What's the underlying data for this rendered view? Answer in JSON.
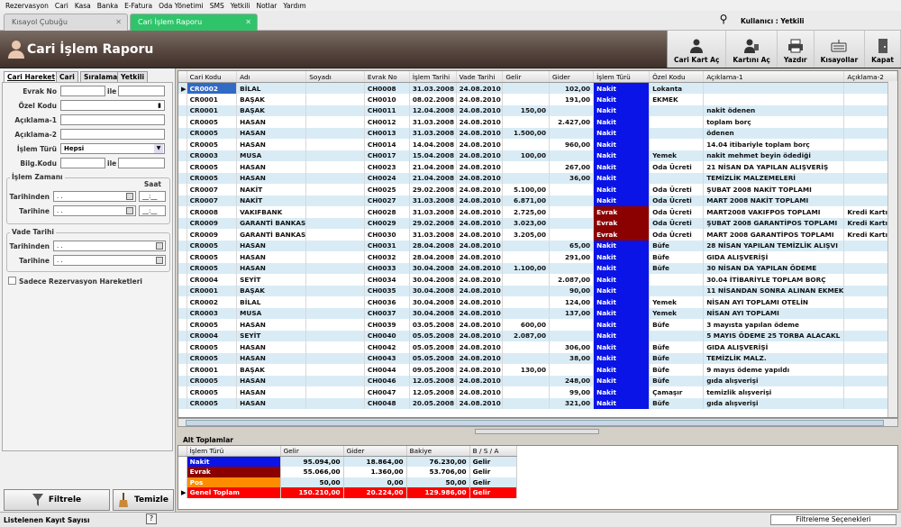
{
  "menu": [
    "Rezervasyon",
    "Cari",
    "Kasa",
    "Banka",
    "E-Fatura",
    "Oda Yönetimi",
    "SMS",
    "Yetkili",
    "Notlar",
    "Yardım"
  ],
  "tabs": [
    {
      "label": "Kısayol Çubuğu"
    },
    {
      "label": "Cari İşlem Raporu"
    }
  ],
  "user_label": "Kullanıcı : Yetkili",
  "page_title": "Cari İşlem Raporu",
  "toolbar": [
    "Cari Kart Aç",
    "Kartını Aç",
    "Yazdır",
    "Kısayollar",
    "Kapat"
  ],
  "left_tabs": [
    "Cari Hareket",
    "Cari",
    "Sıralama",
    "Yetkili"
  ],
  "form": {
    "evrak_no": "Evrak No",
    "ile": "ile",
    "ozel_kodu": "Özel Kodu",
    "aciklama1": "Açıklama-1",
    "aciklama2": "Açıklama-2",
    "islem_turu": "İşlem Türü",
    "islem_turu_value": "Hepsi",
    "bilg_kodu": "Bilg.Kodu",
    "islem_zamani": "İşlem Zamanı",
    "saat": "Saat",
    "tarihinden": "Tarihinden",
    "tarihine": "Tarihine",
    "vade_tarihi": "Vade Tarihi",
    "date_placeholder": " .  .",
    "time_placeholder": "__:__",
    "sadece": "Sadece Rezervasyon Hareketleri"
  },
  "buttons": {
    "filtrele": "Filtrele",
    "temizle": "Temizle"
  },
  "colors": {
    "nakit": "#0a14e6",
    "evrak": "#8b0000",
    "pos": "#ff8c00",
    "genel": "#ff0000"
  },
  "grid": {
    "columns": [
      "Cari Kodu",
      "Adı",
      "Soyadı",
      "Evrak No",
      "İşlem Tarihi",
      "Vade Tarihi",
      "Gelir",
      "Gider",
      "İşlem Türü",
      "Özel Kodu",
      "Açıklama-1",
      "Açıklama-2"
    ],
    "rows": [
      [
        "CR0002",
        "BİLAL",
        "",
        "CH0008",
        "31.03.2008",
        "24.08.2010",
        "",
        "102,00",
        "Nakit",
        "Lokanta",
        "",
        ""
      ],
      [
        "CR0001",
        "BAŞAK",
        "",
        "CH0010",
        "08.02.2008",
        "24.08.2010",
        "",
        "191,00",
        "Nakit",
        "EKMEK",
        "",
        ""
      ],
      [
        "CR0001",
        "BAŞAK",
        "",
        "CH0011",
        "12.04.2008",
        "24.08.2010",
        "150,00",
        "",
        "Nakit",
        "",
        "nakit ödenen",
        ""
      ],
      [
        "CR0005",
        "HASAN",
        "",
        "CH0012",
        "31.03.2008",
        "24.08.2010",
        "",
        "2.427,00",
        "Nakit",
        "",
        "toplam borç",
        ""
      ],
      [
        "CR0005",
        "HASAN",
        "",
        "CH0013",
        "31.03.2008",
        "24.08.2010",
        "1.500,00",
        "",
        "Nakit",
        "",
        "ödenen",
        ""
      ],
      [
        "CR0005",
        "HASAN",
        "",
        "CH0014",
        "14.04.2008",
        "24.08.2010",
        "",
        "960,00",
        "Nakit",
        "",
        "14.04 itibariyle toplam borç",
        ""
      ],
      [
        "CR0003",
        "MUSA",
        "",
        "CH0017",
        "15.04.2008",
        "24.08.2010",
        "100,00",
        "",
        "Nakit",
        "Yemek",
        "nakit mehmet beyin ödediği",
        ""
      ],
      [
        "CR0005",
        "HASAN",
        "",
        "CH0023",
        "21.04.2008",
        "24.08.2010",
        "",
        "267,00",
        "Nakit",
        "Oda Ücreti",
        "21 NİSAN DA YAPILAN ALIŞVERİŞ",
        ""
      ],
      [
        "CR0005",
        "HASAN",
        "",
        "CH0024",
        "21.04.2008",
        "24.08.2010",
        "",
        "36,00",
        "Nakit",
        "",
        "TEMİZLİK MALZEMELERİ",
        ""
      ],
      [
        "CR0007",
        "NAKİT",
        "",
        "CH0025",
        "29.02.2008",
        "24.08.2010",
        "5.100,00",
        "",
        "Nakit",
        "Oda Ücreti",
        "ŞUBAT 2008 NAKİT TOPLAMI",
        ""
      ],
      [
        "CR0007",
        "NAKİT",
        "",
        "CH0027",
        "31.03.2008",
        "24.08.2010",
        "6.871,00",
        "",
        "Nakit",
        "Oda Ücreti",
        "MART 2008  NAKİT TOPLAMI",
        ""
      ],
      [
        "CR0008",
        "VAKIFBANK",
        "",
        "CH0028",
        "31.03.2008",
        "24.08.2010",
        "2.725,00",
        "",
        "Evrak",
        "Oda Ücreti",
        "MART2008 VAKIFPOS TOPLAMI",
        "Kredi Kartı"
      ],
      [
        "CR0009",
        "GARANTİ BANKAS",
        "",
        "CH0029",
        "29.02.2008",
        "24.08.2010",
        "3.023,00",
        "",
        "Evrak",
        "Oda Ücreti",
        "ŞUBAT 2008 GARANTİPOS TOPLAMI",
        "Kredi Kartı"
      ],
      [
        "CR0009",
        "GARANTİ BANKAS",
        "",
        "CH0030",
        "31.03.2008",
        "24.08.2010",
        "3.205,00",
        "",
        "Evrak",
        "Oda Ücreti",
        "MART 2008 GARANTİPOS TOPLAMI",
        "Kredi Kartı"
      ],
      [
        "CR0005",
        "HASAN",
        "",
        "CH0031",
        "28.04.2008",
        "24.08.2010",
        "",
        "65,00",
        "Nakit",
        "Büfe",
        "28 NİSAN YAPILAN TEMİZLİK ALIŞVI",
        ""
      ],
      [
        "CR0005",
        "HASAN",
        "",
        "CH0032",
        "28.04.2008",
        "24.08.2010",
        "",
        "291,00",
        "Nakit",
        "Büfe",
        "GIDA ALIŞVERİŞİ",
        ""
      ],
      [
        "CR0005",
        "HASAN",
        "",
        "CH0033",
        "30.04.2008",
        "24.08.2010",
        "1.100,00",
        "",
        "Nakit",
        "Büfe",
        "30 NİSAN DA YAPILAN ÖDEME",
        ""
      ],
      [
        "CR0004",
        "SEYİT",
        "",
        "CH0034",
        "30.04.2008",
        "24.08.2010",
        "",
        "2.087,00",
        "Nakit",
        "",
        "30.04 İTİBARİYLE TOPLAM BORÇ",
        ""
      ],
      [
        "CR0001",
        "BAŞAK",
        "",
        "CH0035",
        "30.04.2008",
        "24.08.2010",
        "",
        "90,00",
        "Nakit",
        "",
        "11 NİSANDAN SONRA ALINAN EKMEK",
        ""
      ],
      [
        "CR0002",
        "BİLAL",
        "",
        "CH0036",
        "30.04.2008",
        "24.08.2010",
        "",
        "124,00",
        "Nakit",
        "Yemek",
        "NİSAN AYI TOPLAMI OTELİN",
        ""
      ],
      [
        "CR0003",
        "MUSA",
        "",
        "CH0037",
        "30.04.2008",
        "24.08.2010",
        "",
        "137,00",
        "Nakit",
        "Yemek",
        "NİSAN AYI TOPLAMI",
        ""
      ],
      [
        "CR0005",
        "HASAN",
        "",
        "CH0039",
        "03.05.2008",
        "24.08.2010",
        "600,00",
        "",
        "Nakit",
        "Büfe",
        "3 mayısta yapılan ödeme",
        ""
      ],
      [
        "CR0004",
        "SEYİT",
        "",
        "CH0040",
        "05.05.2008",
        "24.08.2010",
        "2.087,00",
        "",
        "Nakit",
        "",
        "5 MAYIS ÖDEME 25 TORBA ALACAKL",
        ""
      ],
      [
        "CR0005",
        "HASAN",
        "",
        "CH0042",
        "05.05.2008",
        "24.08.2010",
        "",
        "306,00",
        "Nakit",
        "Büfe",
        "GIDA ALIŞVERİŞİ",
        ""
      ],
      [
        "CR0005",
        "HASAN",
        "",
        "CH0043",
        "05.05.2008",
        "24.08.2010",
        "",
        "38,00",
        "Nakit",
        "Büfe",
        "TEMİZLİK MALZ.",
        ""
      ],
      [
        "CR0001",
        "BAŞAK",
        "",
        "CH0044",
        "09.05.2008",
        "24.08.2010",
        "130,00",
        "",
        "Nakit",
        "Büfe",
        "9 mayıs ödeme yapıldı",
        ""
      ],
      [
        "CR0005",
        "HASAN",
        "",
        "CH0046",
        "12.05.2008",
        "24.08.2010",
        "",
        "248,00",
        "Nakit",
        "Büfe",
        "gıda alışverişi",
        ""
      ],
      [
        "CR0005",
        "HASAN",
        "",
        "CH0047",
        "12.05.2008",
        "24.08.2010",
        "",
        "99,00",
        "Nakit",
        "Çamaşır",
        "temizlik alışverişi",
        ""
      ],
      [
        "CR0005",
        "HASAN",
        "",
        "CH0048",
        "20.05.2008",
        "24.08.2010",
        "",
        "321,00",
        "Nakit",
        "Büfe",
        "gıda alışverişi",
        ""
      ]
    ]
  },
  "alt_label": "Alt Toplamlar",
  "totals": {
    "columns": [
      "İşlem Türü",
      "Gelir",
      "Gider",
      "Bakiye",
      "B / S / A"
    ],
    "rows": [
      [
        "Nakit",
        "95.094,00",
        "18.864,00",
        "76.230,00",
        "Gelir"
      ],
      [
        "Evrak",
        "55.066,00",
        "1.360,00",
        "53.706,00",
        "Gelir"
      ],
      [
        "Pos",
        "50,00",
        "0,00",
        "50,00",
        "Gelir"
      ],
      [
        "Genel Toplam",
        "150.210,00",
        "20.224,00",
        "129.986,00",
        "Gelir"
      ]
    ]
  },
  "status": {
    "label": "Listelenen Kayıt Sayısı",
    "help": "?",
    "filter": "Filtreleme Seçenekleri"
  }
}
